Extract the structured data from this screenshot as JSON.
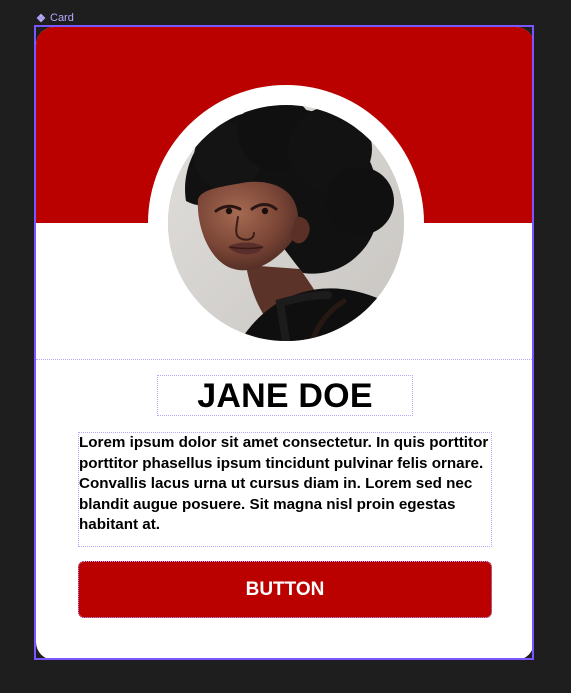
{
  "frame": {
    "label": "Card",
    "icon": "component-icon"
  },
  "card": {
    "name": "JANE DOE",
    "bio": "Lorem ipsum dolor sit amet consectetur. In quis porttitor porttitor phasellus ipsum tincidunt pulvinar felis ornare. Convallis lacus urna ut cursus diam in. Lorem sed nec blandit augue posuere. Sit magna nisl proin egestas habitant at.",
    "button_label": "BUTTON"
  },
  "colors": {
    "background": "#1e1e1e",
    "accent": "#bb0000",
    "card": "#ffffff",
    "selection": "#7b55ff",
    "guide": "#b6a7ff"
  }
}
